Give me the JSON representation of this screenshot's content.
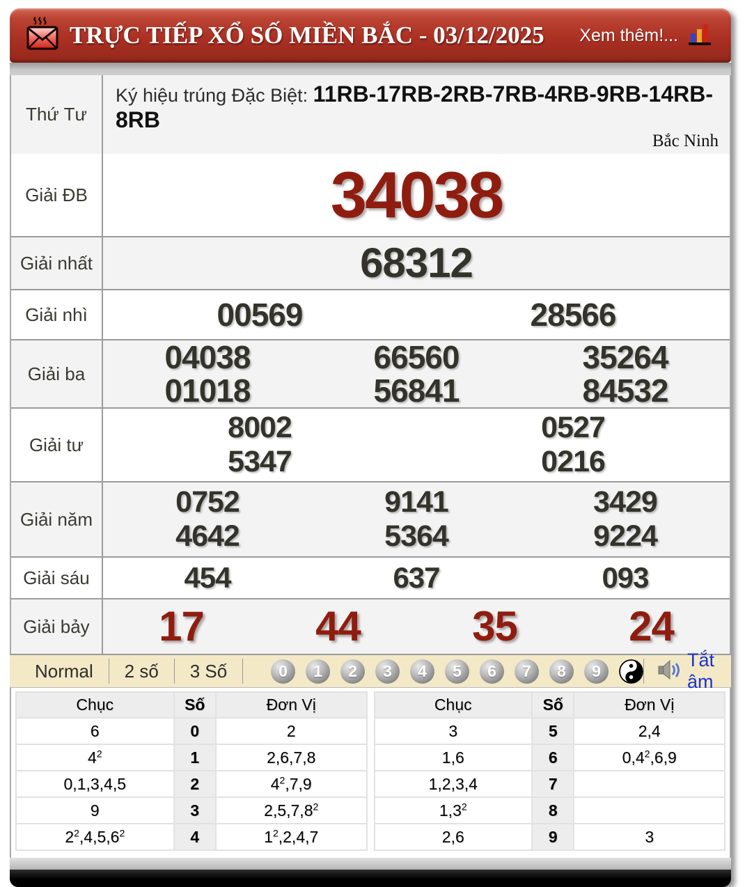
{
  "header": {
    "title": "TRỰC TIẾP XỔ SỐ MIỀN BẮC - 03/12/2025",
    "more_link": "Xem thêm!..."
  },
  "result": {
    "day": "Thứ Tư",
    "sign_label": "Ký hiệu trúng Đặc Biệt: ",
    "sign_value": "11RB-17RB-2RB-7RB-4RB-9RB-14RB-8RB",
    "province": "Bắc Ninh",
    "prizes": [
      {
        "label": "Giải ĐB",
        "lines": [
          [
            "34038"
          ]
        ]
      },
      {
        "label": "Giải nhất",
        "lines": [
          [
            "68312"
          ]
        ]
      },
      {
        "label": "Giải nhì",
        "lines": [
          [
            "00569",
            "28566"
          ]
        ]
      },
      {
        "label": "Giải ba",
        "lines": [
          [
            "04038",
            "66560",
            "35264"
          ],
          [
            "01018",
            "56841",
            "84532"
          ]
        ]
      },
      {
        "label": "Giải tư",
        "lines": [
          [
            "8002",
            "0527"
          ],
          [
            "5347",
            "0216"
          ]
        ]
      },
      {
        "label": "Giải năm",
        "lines": [
          [
            "0752",
            "9141",
            "3429"
          ],
          [
            "4642",
            "5364",
            "9224"
          ]
        ]
      },
      {
        "label": "Giải sáu",
        "lines": [
          [
            "454",
            "637",
            "093"
          ]
        ]
      },
      {
        "label": "Giải bảy",
        "lines": [
          [
            "17",
            "44",
            "35",
            "24"
          ]
        ]
      }
    ]
  },
  "toolbar": {
    "modes": [
      "Normal",
      "2 số",
      "3 Số"
    ],
    "digit_balls": [
      "0",
      "1",
      "2",
      "3",
      "4",
      "5",
      "6",
      "7",
      "8",
      "9"
    ],
    "mute_label": "Tắt âm"
  },
  "head_tail_tables": [
    {
      "headers": [
        "Chục",
        "Số",
        "Đơn Vị"
      ],
      "rows": [
        [
          "6",
          "0",
          "2"
        ],
        [
          "4²",
          "1",
          "2,6,7,8"
        ],
        [
          "0,1,3,4,5",
          "2",
          "4²,7,9"
        ],
        [
          "9",
          "3",
          "2,5,7,8²"
        ],
        [
          "2²,4,5,6²",
          "4",
          "1²,2,4,7"
        ]
      ]
    },
    {
      "headers": [
        "Chục",
        "Số",
        "Đơn Vị"
      ],
      "rows": [
        [
          "3",
          "5",
          "2,4"
        ],
        [
          "1,6",
          "6",
          "0,4²,6,9"
        ],
        [
          "1,2,3,4",
          "7",
          ""
        ],
        [
          "1,3²",
          "8",
          ""
        ],
        [
          "2,6",
          "9",
          "3"
        ]
      ]
    }
  ],
  "colors": {
    "header_red": "#ab3023",
    "special_red": "#8e1d10",
    "number_dark": "#33332b",
    "toolbar_cream": "#f3e9c7",
    "mute_blue": "#1a35cc"
  }
}
